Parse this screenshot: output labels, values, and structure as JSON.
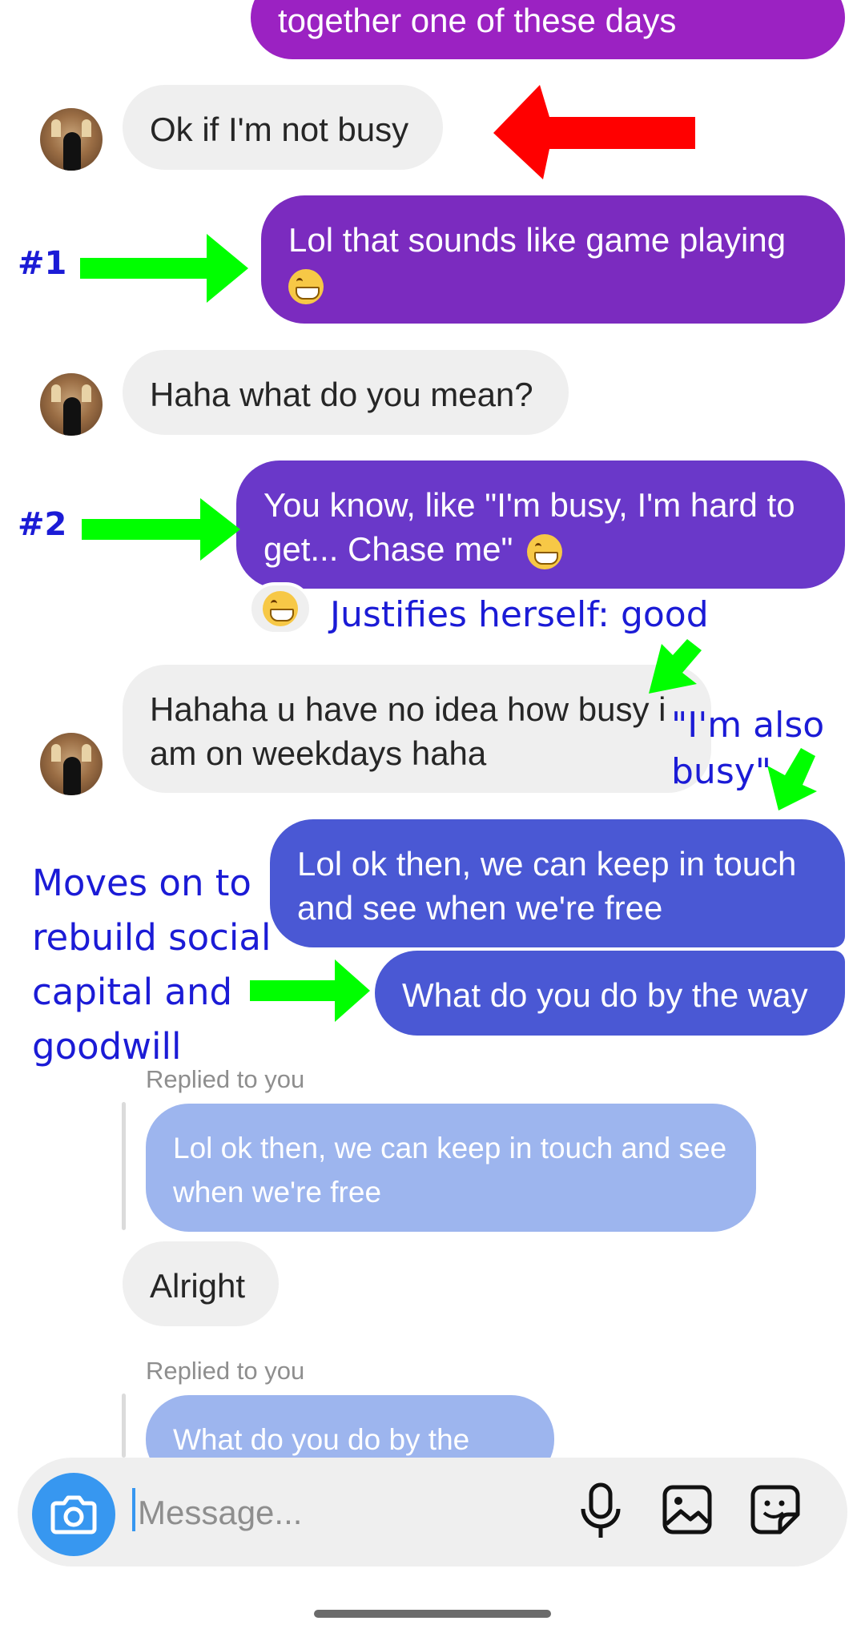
{
  "messages": {
    "m0": "together one of these days",
    "m1": "Ok if I'm not busy",
    "m2": "Lol that sounds like game playing",
    "m3": "Haha what do you mean?",
    "m4": "You know, like \"I'm busy, I'm hard to get... Chase me\"",
    "m5": "Hahaha u have no idea how busy i am on weekdays haha",
    "m6": "Lol ok then, we can keep in touch and see when we're free",
    "m7": "What do you do by the way",
    "m8": "Alright"
  },
  "replies": {
    "label1": "Replied to you",
    "quote1": "Lol ok then, we can keep in touch and see when we're free",
    "label2": "Replied to you",
    "quote2": "What do you do by the way"
  },
  "annotations": {
    "n1": "#1",
    "n2": "#2",
    "justifies": "Justifies herself: good",
    "busy_line1": "\"I'm also",
    "busy_line2": "busy\"",
    "moves1": "Moves on to",
    "moves2": "rebuild social",
    "moves3": "capital and",
    "moves4": "goodwill"
  },
  "composer": {
    "placeholder": "Message..."
  },
  "colors": {
    "bubble_purple_top": "#9b22c2",
    "bubble_purple": "#7b2bbf",
    "bubble_violet": "#6a38c9",
    "bubble_blue": "#4a58d4",
    "reply_quote": "#9db5ee",
    "incoming": "#efefef",
    "accent": "#3797f0",
    "arrow_green": "#00ff00",
    "arrow_red": "#ff0000",
    "note_blue": "#1b1bd6"
  },
  "icons": [
    "camera-icon",
    "microphone-icon",
    "gallery-icon",
    "sticker-icon",
    "laugh-reaction-icon",
    "grin-emoji-icon"
  ]
}
